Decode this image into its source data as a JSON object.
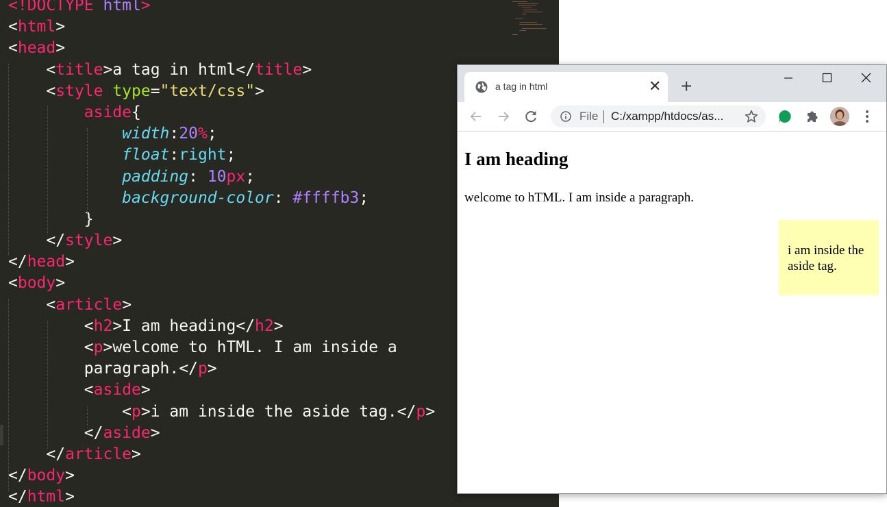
{
  "editor": {
    "lines": [
      [
        [
          "tg",
          "<!DOCTYPE "
        ],
        [
          "nm",
          "html"
        ],
        [
          "tg",
          ">"
        ]
      ],
      [
        [
          "p",
          "<"
        ],
        [
          "tg",
          "html"
        ],
        [
          "p",
          ">"
        ]
      ],
      [
        [
          "p",
          "<"
        ],
        [
          "tg",
          "head"
        ],
        [
          "p",
          ">"
        ]
      ],
      [
        [
          "p",
          "    <"
        ],
        [
          "tg",
          "title"
        ],
        [
          "p",
          ">a tag in html</"
        ],
        [
          "tg",
          "title"
        ],
        [
          "p",
          ">"
        ]
      ],
      [
        [
          "p",
          "    <"
        ],
        [
          "tg",
          "style"
        ],
        [
          "p",
          " "
        ],
        [
          "at",
          "type"
        ],
        [
          "p",
          "="
        ],
        [
          "st",
          "\"text/css\""
        ],
        [
          "p",
          ">"
        ]
      ],
      [
        [
          "p",
          "        "
        ],
        [
          "tg",
          "aside"
        ],
        [
          "p",
          "{"
        ]
      ],
      [
        [
          "p",
          "            "
        ],
        [
          "pr",
          "width"
        ],
        [
          "p",
          ":"
        ],
        [
          "nm",
          "20"
        ],
        [
          "un",
          "%"
        ],
        [
          "p",
          ";"
        ]
      ],
      [
        [
          "p",
          "            "
        ],
        [
          "pr",
          "float"
        ],
        [
          "p",
          ":"
        ],
        [
          "vl",
          "right"
        ],
        [
          "p",
          ";"
        ]
      ],
      [
        [
          "p",
          "            "
        ],
        [
          "pr",
          "padding"
        ],
        [
          "p",
          ": "
        ],
        [
          "nm",
          "10"
        ],
        [
          "un",
          "px"
        ],
        [
          "p",
          ";"
        ]
      ],
      [
        [
          "p",
          "            "
        ],
        [
          "pr",
          "background-color"
        ],
        [
          "p",
          ": "
        ],
        [
          "nm",
          "#ffffb3"
        ],
        [
          "p",
          ";"
        ]
      ],
      [
        [
          "p",
          "        }"
        ]
      ],
      [
        [
          "p",
          "    </"
        ],
        [
          "tg",
          "style"
        ],
        [
          "p",
          ">"
        ]
      ],
      [
        [
          "p",
          "</"
        ],
        [
          "tg",
          "head"
        ],
        [
          "p",
          ">"
        ]
      ],
      [
        [
          "p",
          "<"
        ],
        [
          "tg",
          "body"
        ],
        [
          "p",
          ">"
        ]
      ],
      [
        [
          "p",
          "    <"
        ],
        [
          "tg",
          "article"
        ],
        [
          "p",
          ">"
        ]
      ],
      [
        [
          "p",
          "        <"
        ],
        [
          "tg",
          "h2"
        ],
        [
          "p",
          ">I am heading</"
        ],
        [
          "tg",
          "h2"
        ],
        [
          "p",
          ">"
        ]
      ],
      [
        [
          "p",
          "        <"
        ],
        [
          "tg",
          "p"
        ],
        [
          "p",
          ">welcome to hTML. I am inside a"
        ]
      ],
      [
        [
          "p",
          "        paragraph.</"
        ],
        [
          "tg",
          "p"
        ],
        [
          "p",
          ">"
        ]
      ],
      [
        [
          "p",
          "        <"
        ],
        [
          "tg",
          "aside"
        ],
        [
          "p",
          ">"
        ]
      ],
      [
        [
          "p",
          "            <"
        ],
        [
          "tg",
          "p"
        ],
        [
          "p",
          ">i am inside the aside tag.</"
        ],
        [
          "tg",
          "p"
        ],
        [
          "p",
          ">"
        ]
      ],
      [
        [
          "p",
          "        </"
        ],
        [
          "tg",
          "aside"
        ],
        [
          "p",
          ">"
        ]
      ],
      [
        [
          "p",
          "    </"
        ],
        [
          "tg",
          "article"
        ],
        [
          "p",
          ">"
        ]
      ],
      [
        [
          "p",
          "</"
        ],
        [
          "tg",
          "body"
        ],
        [
          "p",
          ">"
        ]
      ],
      [
        [
          "p",
          "</"
        ],
        [
          "tg",
          "html"
        ],
        [
          "p",
          ">"
        ]
      ]
    ]
  },
  "browser": {
    "tab": {
      "title": "a tag in html",
      "close_glyph": "✕",
      "icon": "globe-icon"
    },
    "new_tab_glyph": "+",
    "address": {
      "scheme_label": "File",
      "url": "C:/xampp/htdocs/as..."
    },
    "page": {
      "heading": "I am heading",
      "paragraph": "welcome to hTML. I am inside a paragraph.",
      "aside_text": "i am inside the aside tag."
    },
    "colors": {
      "tabstrip": "#dee1e6",
      "aside_bg": "#ffffb3",
      "extension_green": "#0f9d58"
    }
  }
}
